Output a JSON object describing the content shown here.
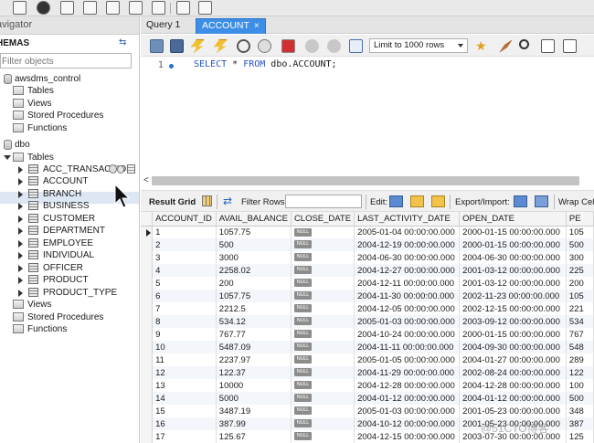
{
  "navigator": {
    "title": "avigator",
    "schemas_label": "HEMAS",
    "filter_placeholder": "Filter objects",
    "tree": {
      "db1": "awsdms_control",
      "db1_tables": "Tables",
      "db1_views": "Views",
      "db1_procs": "Stored Procedures",
      "db1_funcs": "Functions",
      "db2": "dbo",
      "db2_tables": "Tables",
      "tables": [
        "ACC_TRANSACTION",
        "ACCOUNT",
        "BRANCH",
        "BUSINESS",
        "CUSTOMER",
        "DEPARTMENT",
        "EMPLOYEE",
        "INDIVIDUAL",
        "OFFICER",
        "PRODUCT",
        "PRODUCT_TYPE"
      ],
      "db2_views": "Views",
      "db2_procs": "Stored Procedures",
      "db2_funcs": "Functions"
    }
  },
  "tabs": [
    {
      "label": "Query 1",
      "active": false
    },
    {
      "label": "ACCOUNT",
      "active": true,
      "close": "×"
    }
  ],
  "editor_toolbar": {
    "limit_label": "Limit to 1000 rows"
  },
  "editor": {
    "line_number": "1",
    "sql_keyword_1": "SELECT",
    "sql_star": " * ",
    "sql_keyword_2": "FROM",
    "sql_rest": " dbo.ACCOUNT;"
  },
  "result_toolbar": {
    "result_grid": "Result Grid",
    "filter_rows": "Filter Rows:",
    "edit": "Edit:",
    "export_import": "Export/Import:",
    "wrap_cell": "Wrap Cell"
  },
  "grid": {
    "columns": [
      "ACCOUNT_ID",
      "AVAIL_BALANCE",
      "CLOSE_DATE",
      "LAST_ACTIVITY_DATE",
      "OPEN_DATE",
      "PE"
    ],
    "null_text": "NULL",
    "rows": [
      [
        "1",
        "1057.75",
        "2005-01-04 00:00:00.000",
        "2000-01-15 00:00:00.000",
        "105"
      ],
      [
        "2",
        "500",
        "2004-12-19 00:00:00.000",
        "2000-01-15 00:00:00.000",
        "500"
      ],
      [
        "3",
        "3000",
        "2004-06-30 00:00:00.000",
        "2004-06-30 00:00:00.000",
        "300"
      ],
      [
        "4",
        "2258.02",
        "2004-12-27 00:00:00.000",
        "2001-03-12 00:00:00.000",
        "225"
      ],
      [
        "5",
        "200",
        "2004-12-11 00:00:00.000",
        "2001-03-12 00:00:00.000",
        "200"
      ],
      [
        "6",
        "1057.75",
        "2004-11-30 00:00:00.000",
        "2002-11-23 00:00:00.000",
        "105"
      ],
      [
        "7",
        "2212.5",
        "2004-12-05 00:00:00.000",
        "2002-12-15 00:00:00.000",
        "221"
      ],
      [
        "8",
        "534.12",
        "2005-01-03 00:00:00.000",
        "2003-09-12 00:00:00.000",
        "534"
      ],
      [
        "9",
        "767.77",
        "2004-10-24 00:00:00.000",
        "2000-01-15 00:00:00.000",
        "767"
      ],
      [
        "10",
        "5487.09",
        "2004-11-11 00:00:00.000",
        "2004-09-30 00:00:00.000",
        "548"
      ],
      [
        "11",
        "2237.97",
        "2005-01-05 00:00:00.000",
        "2004-01-27 00:00:00.000",
        "289"
      ],
      [
        "12",
        "122.37",
        "2004-11-29 00:00:00.000",
        "2002-08-24 00:00:00.000",
        "122"
      ],
      [
        "13",
        "10000",
        "2004-12-28 00:00:00.000",
        "2004-12-28 00:00:00.000",
        "100"
      ],
      [
        "14",
        "5000",
        "2004-01-12 00:00:00.000",
        "2004-01-12 00:00:00.000",
        "500"
      ],
      [
        "15",
        "3487.19",
        "2005-01-03 00:00:00.000",
        "2001-05-23 00:00:00.000",
        "348"
      ],
      [
        "16",
        "387.99",
        "2004-10-12 00:00:00.000",
        "2001-05-23 00:00:00.000",
        "387"
      ],
      [
        "17",
        "125.67",
        "2004-12-15 00:00:00.000",
        "2003-07-30 00:00:00.000",
        "125"
      ]
    ]
  },
  "watermark": "@51CTO博客"
}
